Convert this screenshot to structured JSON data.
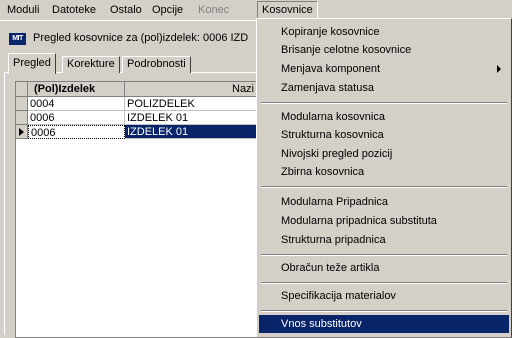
{
  "menubar": {
    "items": [
      {
        "label": "Moduli",
        "state": "normal"
      },
      {
        "label": "Datoteke",
        "state": "normal"
      },
      {
        "label": "Ostalo",
        "state": "normal"
      },
      {
        "label": "Opcije",
        "state": "normal"
      },
      {
        "label": "Konec",
        "state": "disabled"
      },
      {
        "label": "Kosovnice",
        "state": "open"
      }
    ]
  },
  "window": {
    "icon_text": "MIT",
    "title": "Pregled kosovnice za (pol)izdelek: 0006 IZD"
  },
  "tabs": [
    {
      "label": "Pregled",
      "active": true
    },
    {
      "label": "Korekture",
      "active": false
    },
    {
      "label": "Podrobnosti",
      "active": false
    }
  ],
  "grid": {
    "columns": [
      "(Pol)Izdelek",
      "Nazi"
    ],
    "rows": [
      {
        "code": "0004",
        "name": "POLIZDELEK",
        "selected": false
      },
      {
        "code": "0006",
        "name": "IZDELEK 01",
        "selected": false
      },
      {
        "code": "0006",
        "name": "IZDELEK 01",
        "selected": true
      }
    ]
  },
  "dropdown": {
    "items": [
      {
        "label": "Kopiranje kosovnice",
        "type": "item"
      },
      {
        "label": "Brisanje celotne kosovnice",
        "type": "item"
      },
      {
        "label": "Menjava komponent",
        "type": "submenu"
      },
      {
        "label": "Zamenjava statusa",
        "type": "item"
      },
      {
        "type": "separator"
      },
      {
        "label": "Modularna kosovnica",
        "type": "item"
      },
      {
        "label": "Strukturna kosovnica",
        "type": "item"
      },
      {
        "label": "Nivojski pregled pozicij",
        "type": "item"
      },
      {
        "label": "Zbirna kosovnica",
        "type": "item"
      },
      {
        "type": "separator"
      },
      {
        "label": "Modularna Pripadnica",
        "type": "item"
      },
      {
        "label": "Modularna pripadnica substituta",
        "type": "item"
      },
      {
        "label": "Strukturna pripadnica",
        "type": "item"
      },
      {
        "type": "separator"
      },
      {
        "label": "Obračun teže artikla",
        "type": "item"
      },
      {
        "type": "separator"
      },
      {
        "label": "Specifikacija materialov",
        "type": "item"
      },
      {
        "type": "separator"
      },
      {
        "label": "Vnos substitutov",
        "type": "item",
        "highlighted": true
      }
    ]
  },
  "colors": {
    "selection": "#0a246a",
    "face": "#d4d0c8"
  }
}
